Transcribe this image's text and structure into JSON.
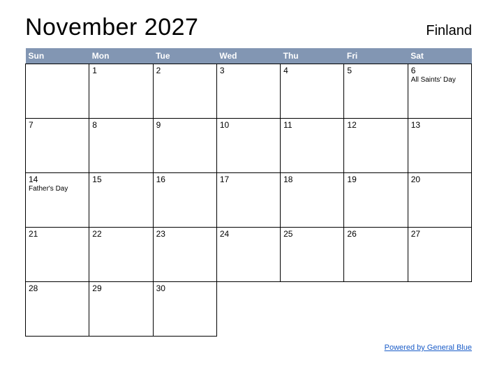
{
  "header": {
    "title": "November 2027",
    "region": "Finland"
  },
  "weekdays": [
    "Sun",
    "Mon",
    "Tue",
    "Wed",
    "Thu",
    "Fri",
    "Sat"
  ],
  "weeks": [
    [
      {
        "day": "",
        "event": ""
      },
      {
        "day": "1",
        "event": ""
      },
      {
        "day": "2",
        "event": ""
      },
      {
        "day": "3",
        "event": ""
      },
      {
        "day": "4",
        "event": ""
      },
      {
        "day": "5",
        "event": ""
      },
      {
        "day": "6",
        "event": "All Saints' Day"
      }
    ],
    [
      {
        "day": "7",
        "event": ""
      },
      {
        "day": "8",
        "event": ""
      },
      {
        "day": "9",
        "event": ""
      },
      {
        "day": "10",
        "event": ""
      },
      {
        "day": "11",
        "event": ""
      },
      {
        "day": "12",
        "event": ""
      },
      {
        "day": "13",
        "event": ""
      }
    ],
    [
      {
        "day": "14",
        "event": "Father's Day"
      },
      {
        "day": "15",
        "event": ""
      },
      {
        "day": "16",
        "event": ""
      },
      {
        "day": "17",
        "event": ""
      },
      {
        "day": "18",
        "event": ""
      },
      {
        "day": "19",
        "event": ""
      },
      {
        "day": "20",
        "event": ""
      }
    ],
    [
      {
        "day": "21",
        "event": ""
      },
      {
        "day": "22",
        "event": ""
      },
      {
        "day": "23",
        "event": ""
      },
      {
        "day": "24",
        "event": ""
      },
      {
        "day": "25",
        "event": ""
      },
      {
        "day": "26",
        "event": ""
      },
      {
        "day": "27",
        "event": ""
      }
    ],
    [
      {
        "day": "28",
        "event": ""
      },
      {
        "day": "29",
        "event": ""
      },
      {
        "day": "30",
        "event": ""
      },
      {
        "day": "",
        "event": "",
        "trailing": true
      },
      {
        "day": "",
        "event": "",
        "trailing": true
      },
      {
        "day": "",
        "event": "",
        "trailing": true
      },
      {
        "day": "",
        "event": "",
        "trailing": true
      }
    ]
  ],
  "footer": {
    "link_text": "Powered by General Blue"
  }
}
